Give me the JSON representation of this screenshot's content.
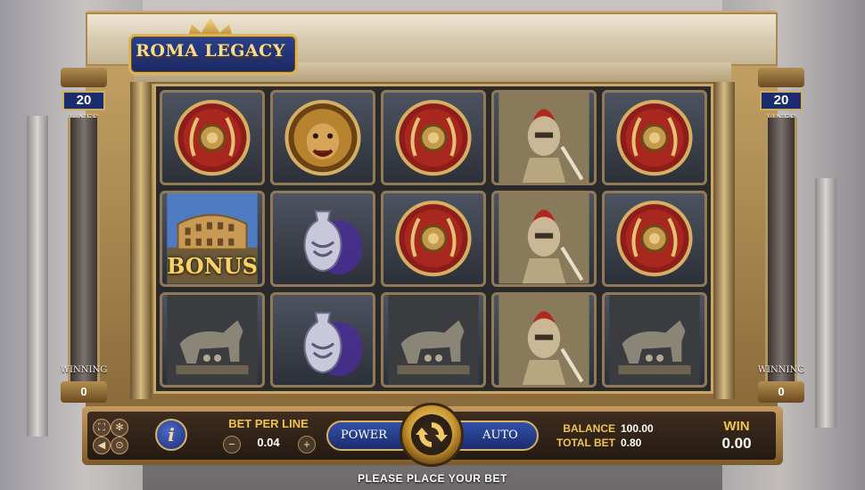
{
  "game": {
    "title": "ROMA LEGACY"
  },
  "left_panel": {
    "lines_count": "20",
    "lines_label": "LINES",
    "winning_label": "WINNING",
    "winning_value": "0"
  },
  "right_panel": {
    "lines_count": "20",
    "lines_label": "LINES",
    "winning_label": "WINNING",
    "winning_value": "0"
  },
  "reels": [
    [
      "shield",
      "coliseum-bonus",
      "she-wolf"
    ],
    [
      "lion",
      "amphora",
      "amphora"
    ],
    [
      "shield",
      "shield",
      "she-wolf"
    ],
    [
      "gladiator",
      "gladiator",
      "gladiator"
    ],
    [
      "shield",
      "shield",
      "she-wolf"
    ]
  ],
  "bonus_label": "BONUS",
  "controls": {
    "info_glyph": "i",
    "bet_per_line_label": "BET PER LINE",
    "bet_per_line_value": "0.04",
    "decrease_glyph": "−",
    "increase_glyph": "+",
    "power_label": "POWER",
    "auto_label": "AUTO",
    "balance_label": "BALANCE",
    "balance_value": "100.00",
    "total_bet_label": "TOTAL BET",
    "total_bet_value": "0.80",
    "win_label": "WIN",
    "win_value": "0.00"
  },
  "small_icons": [
    "fullscreen-icon",
    "settings-icon",
    "sound-icon",
    "history-icon"
  ],
  "status_message": "PLEASE PLACE YOUR BET",
  "colors": {
    "accent_gold": "#f1c34b",
    "button_blue": "#1b2c6d",
    "frame_gold": "#c9a865"
  }
}
